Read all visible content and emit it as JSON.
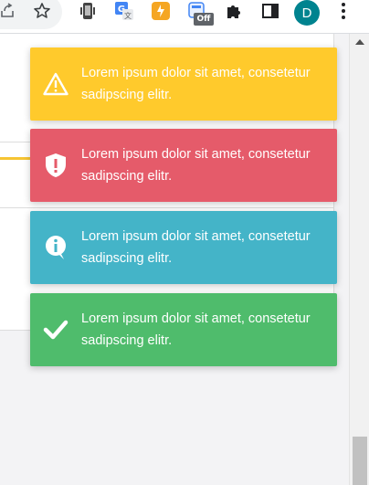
{
  "browser": {
    "extensions": [
      {
        "name": "share-icon"
      },
      {
        "name": "bookmark-star-icon"
      },
      {
        "name": "phone-extension-icon"
      },
      {
        "name": "google-translate-icon"
      },
      {
        "name": "orange-extension-icon"
      },
      {
        "name": "toggle-extension-icon",
        "badge": "Off"
      },
      {
        "name": "extensions-puzzle-icon"
      },
      {
        "name": "side-panel-icon"
      }
    ],
    "profile_initial": "D",
    "profile_color": "#00838f",
    "menu": "kebab-menu-icon"
  },
  "toasts": [
    {
      "type": "warning",
      "icon": "warning-icon",
      "color": "#ffca2c",
      "message": "Lorem ipsum dolor sit amet, consetetur sadipscing elitr."
    },
    {
      "type": "error",
      "icon": "shield-alert-icon",
      "color": "#e55b6a",
      "message": "Lorem ipsum dolor sit amet, consetetur sadipscing elitr."
    },
    {
      "type": "info",
      "icon": "info-bubble-icon",
      "color": "#44b4c8",
      "message": "Lorem ipsum dolor sit amet, consetetur sadipscing elitr."
    },
    {
      "type": "success",
      "icon": "checkmark-icon",
      "color": "#4fbc6c",
      "message": "Lorem ipsum dolor sit amet, consetetur sadipscing elitr."
    }
  ]
}
